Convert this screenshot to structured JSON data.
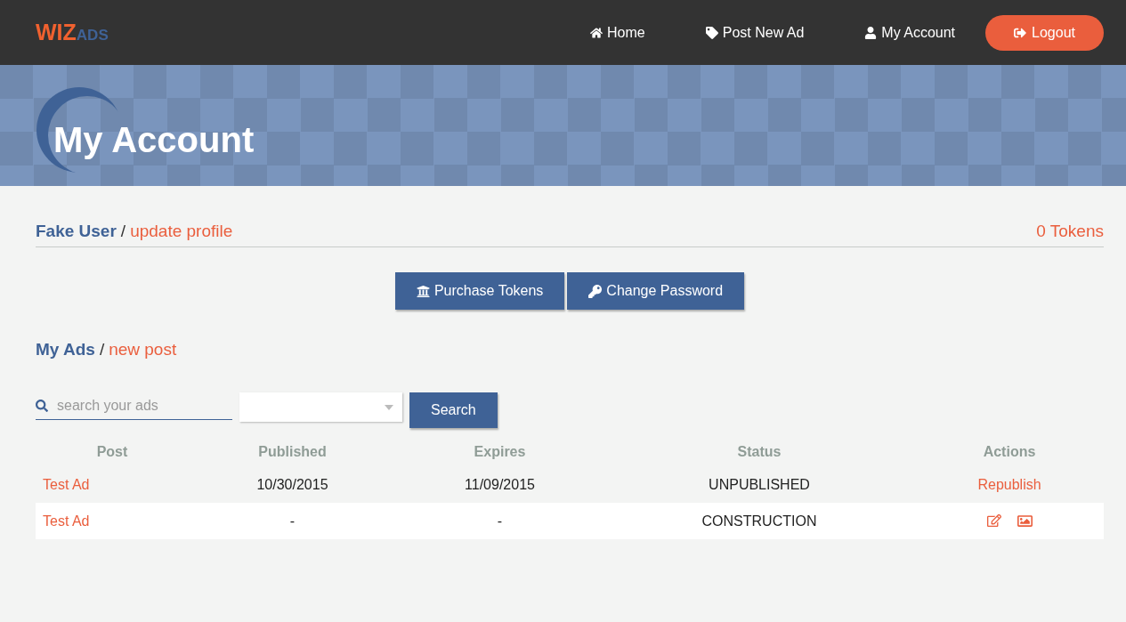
{
  "brand": {
    "part_1": "WIZ",
    "part_2": "ADS"
  },
  "nav": [
    {
      "label": "Home"
    },
    {
      "label": "Post New Ad"
    },
    {
      "label": "My Account"
    }
  ],
  "logout": "Logout",
  "banner": {
    "title": "My Account"
  },
  "profile": {
    "name": "Fake User",
    "separator": "/",
    "link": "update profile",
    "tokens": "0 Tokens"
  },
  "buttons": [
    "Purchase Tokens",
    "Change Password"
  ],
  "ads": {
    "title": "My Ads",
    "separator": "/",
    "link": "new post"
  },
  "search": {
    "placeholder": "search your ads",
    "button": "Search"
  },
  "table": {
    "columns": [
      "Post",
      "Published",
      "Expires",
      "Status",
      "Actions"
    ],
    "rows": [
      {
        "post": "Test Ad",
        "published": "10/30/2015",
        "expires": "11/09/2015",
        "status": "UNPUBLISHED",
        "action": {
          "kind": "link",
          "label": "Republish"
        }
      },
      {
        "post": "Test Ad",
        "published": "-",
        "expires": "-",
        "status": "CONSTRUCTION",
        "action": {
          "kind": "icons"
        }
      }
    ]
  }
}
